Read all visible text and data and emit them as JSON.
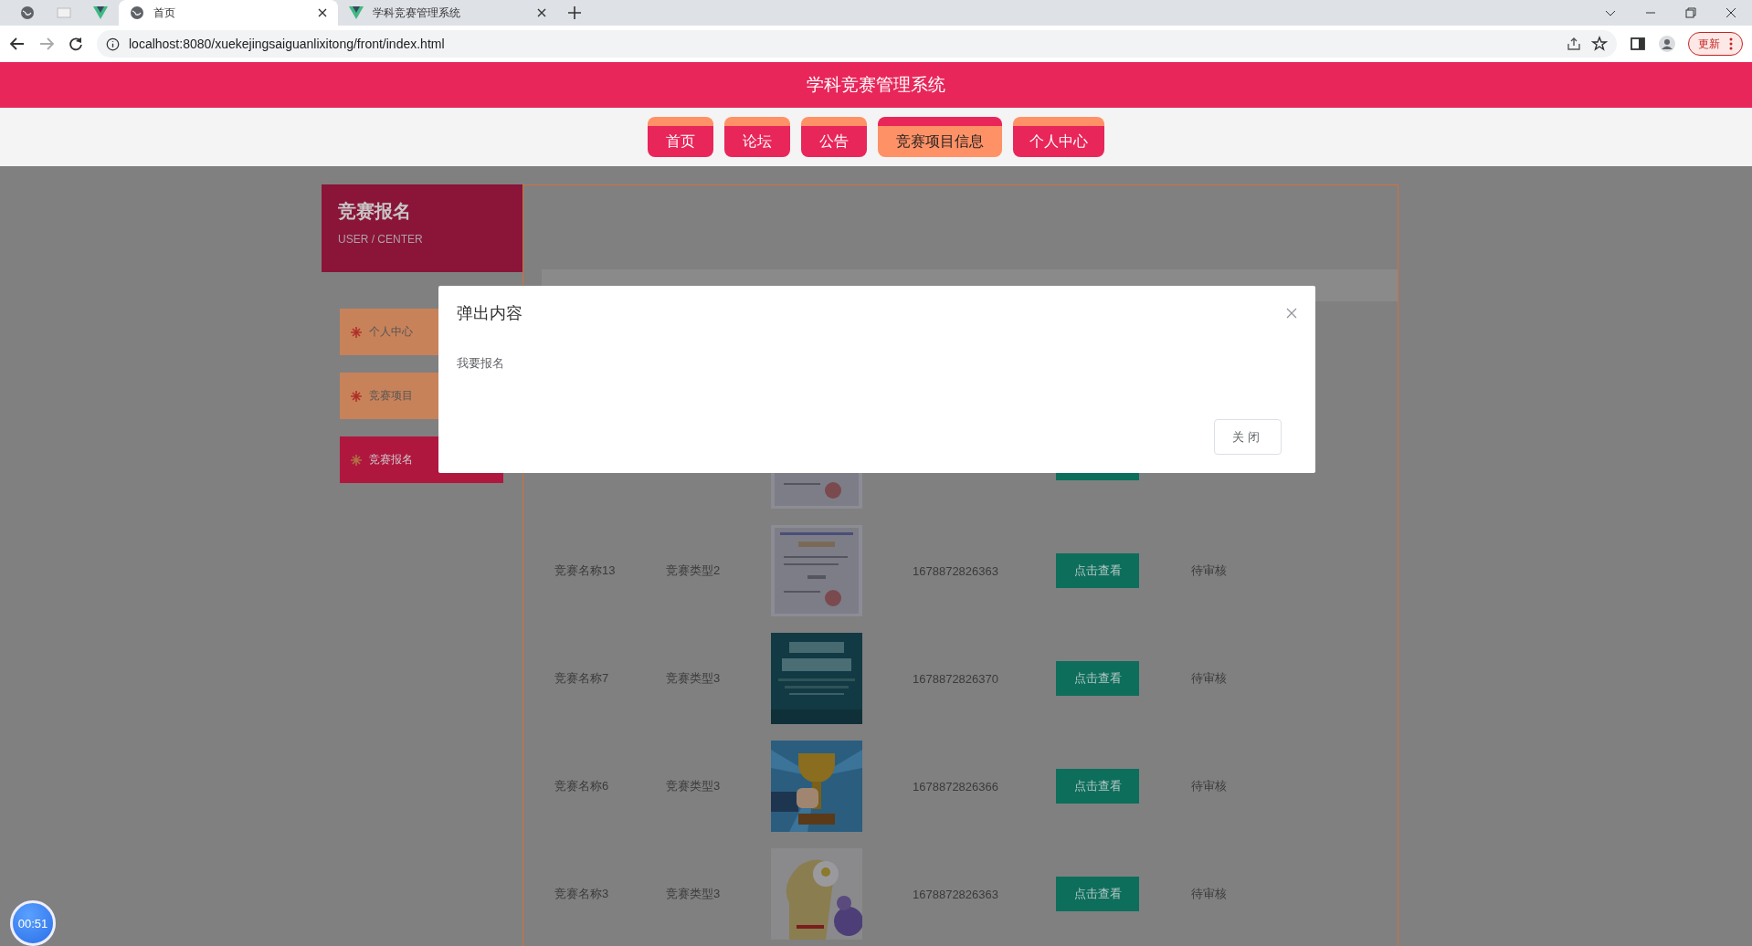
{
  "browser": {
    "tabs": [
      {
        "title": "首页",
        "selected": true
      },
      {
        "title": "学科竞赛管理系统",
        "selected": false
      }
    ],
    "url": "localhost:8080/xuekejingsaiguanlixitong/front/index.html",
    "update_button": "更新"
  },
  "site_title": "学科竞赛管理系统",
  "nav": [
    {
      "label": "首页",
      "selected": false
    },
    {
      "label": "论坛",
      "selected": false
    },
    {
      "label": "公告",
      "selected": false
    },
    {
      "label": "竞赛项目信息",
      "selected": true
    },
    {
      "label": "个人中心",
      "selected": false
    }
  ],
  "sidebar": {
    "title": "竞赛报名",
    "subtitle": "USER / CENTER",
    "items": [
      {
        "label": "个人中心",
        "selected": false
      },
      {
        "label": "竞赛项目",
        "selected": false
      },
      {
        "label": "竞赛报名",
        "selected": true
      }
    ]
  },
  "table": {
    "rows": [
      {
        "kind": "partial"
      },
      {
        "kind": "full",
        "name": "竞赛名称13",
        "type": "竞赛类型2",
        "number": "1678872826363",
        "action": "点击查看",
        "status": "待审核"
      },
      {
        "kind": "full",
        "name": "竞赛名称7",
        "type": "竞赛类型3",
        "number": "1678872826370",
        "action": "点击查看",
        "status": "待审核"
      },
      {
        "kind": "full",
        "name": "竞赛名称6",
        "type": "竞赛类型3",
        "number": "1678872826366",
        "action": "点击查看",
        "status": "待审核"
      },
      {
        "kind": "full",
        "name": "竞赛名称3",
        "type": "竞赛类型3",
        "number": "1678872826363",
        "action": "点击查看",
        "status": "待审核"
      }
    ]
  },
  "modal": {
    "title": "弹出内容",
    "body": "我要报名",
    "close_button": "关闭"
  },
  "timer": "00:51"
}
